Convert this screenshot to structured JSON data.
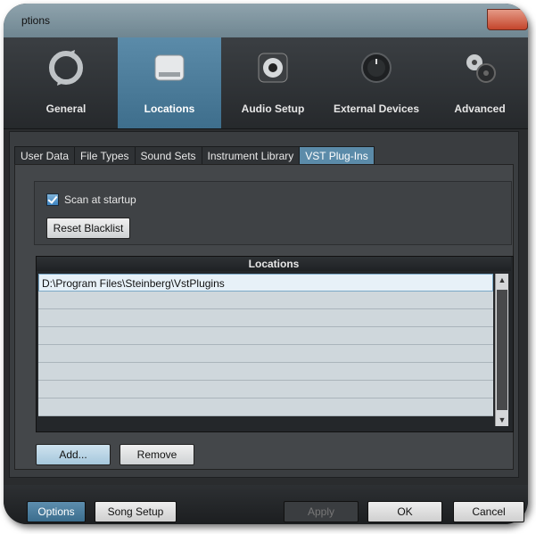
{
  "window": {
    "title": "ptions"
  },
  "toolbar": {
    "items": [
      {
        "label": "General",
        "icon": "refresh-icon",
        "active": false
      },
      {
        "label": "Locations",
        "icon": "drive-icon",
        "active": true
      },
      {
        "label": "Audio Setup",
        "icon": "speaker-icon",
        "active": false
      },
      {
        "label": "External Devices",
        "icon": "knob-icon",
        "active": false
      },
      {
        "label": "Advanced",
        "icon": "gears-icon",
        "active": false
      }
    ]
  },
  "tabs": [
    {
      "label": "User Data",
      "active": false
    },
    {
      "label": "File Types",
      "active": false
    },
    {
      "label": "Sound Sets",
      "active": false
    },
    {
      "label": "Instrument Library",
      "active": false
    },
    {
      "label": "VST Plug-Ins",
      "active": true
    }
  ],
  "options": {
    "scan_label": "Scan at startup",
    "scan_checked": true,
    "reset_label": "Reset Blacklist"
  },
  "locations": {
    "header": "Locations",
    "rows": [
      "D:\\Program Files\\Steinberg\\VstPlugins",
      "",
      "",
      "",
      "",
      "",
      "",
      "",
      ""
    ],
    "add_label": "Add...",
    "remove_label": "Remove"
  },
  "bottom": {
    "options_label": "Options",
    "song_setup_label": "Song Setup",
    "apply_label": "Apply",
    "ok_label": "OK",
    "cancel_label": "Cancel"
  },
  "colors": {
    "accent": "#5b8ba9",
    "background": "#2a2c2e"
  }
}
